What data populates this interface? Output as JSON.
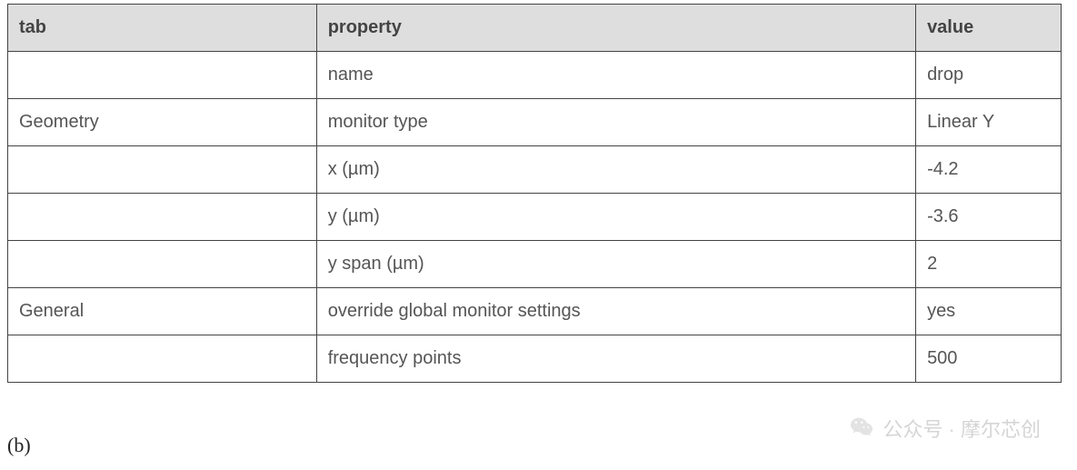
{
  "table": {
    "headers": {
      "tab": "tab",
      "property": "property",
      "value": "value"
    },
    "rows": [
      {
        "tab": "",
        "property": "name",
        "value": "drop"
      },
      {
        "tab": "Geometry",
        "property": "monitor type",
        "value": "Linear Y"
      },
      {
        "tab": "",
        "property": "x (µm)",
        "value": "-4.2"
      },
      {
        "tab": "",
        "property": "y  (µm)",
        "value": "-3.6"
      },
      {
        "tab": "",
        "property": "y span (µm)",
        "value": "2"
      },
      {
        "tab": "General",
        "property": "override global monitor settings",
        "value": "yes"
      },
      {
        "tab": "",
        "property": "frequency points",
        "value": "500"
      }
    ]
  },
  "caption": "(b)",
  "watermark": {
    "text": "公众号 · 摩尔芯创"
  }
}
